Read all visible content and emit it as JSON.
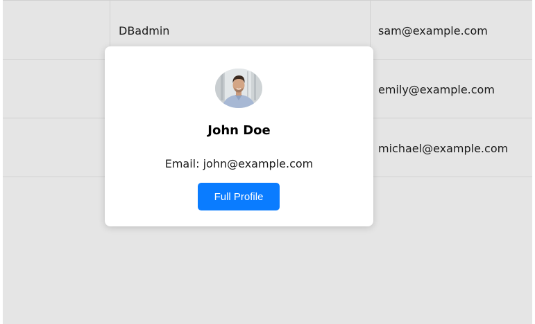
{
  "table": {
    "rows": [
      {
        "name": "DBadmin",
        "email": "sam@example.com"
      },
      {
        "name": "",
        "email": "emily@example.com"
      },
      {
        "name": "",
        "email": "michael@example.com"
      }
    ]
  },
  "popup": {
    "name": "John Doe",
    "email_label": "Email:",
    "email": "john@example.com",
    "button_label": "Full Profile",
    "avatar_icon": "person-photo-avatar"
  },
  "colors": {
    "background": "#e5e5e5",
    "card": "#ffffff",
    "button": "#0a7cff",
    "gridline": "#d0d0d0"
  }
}
